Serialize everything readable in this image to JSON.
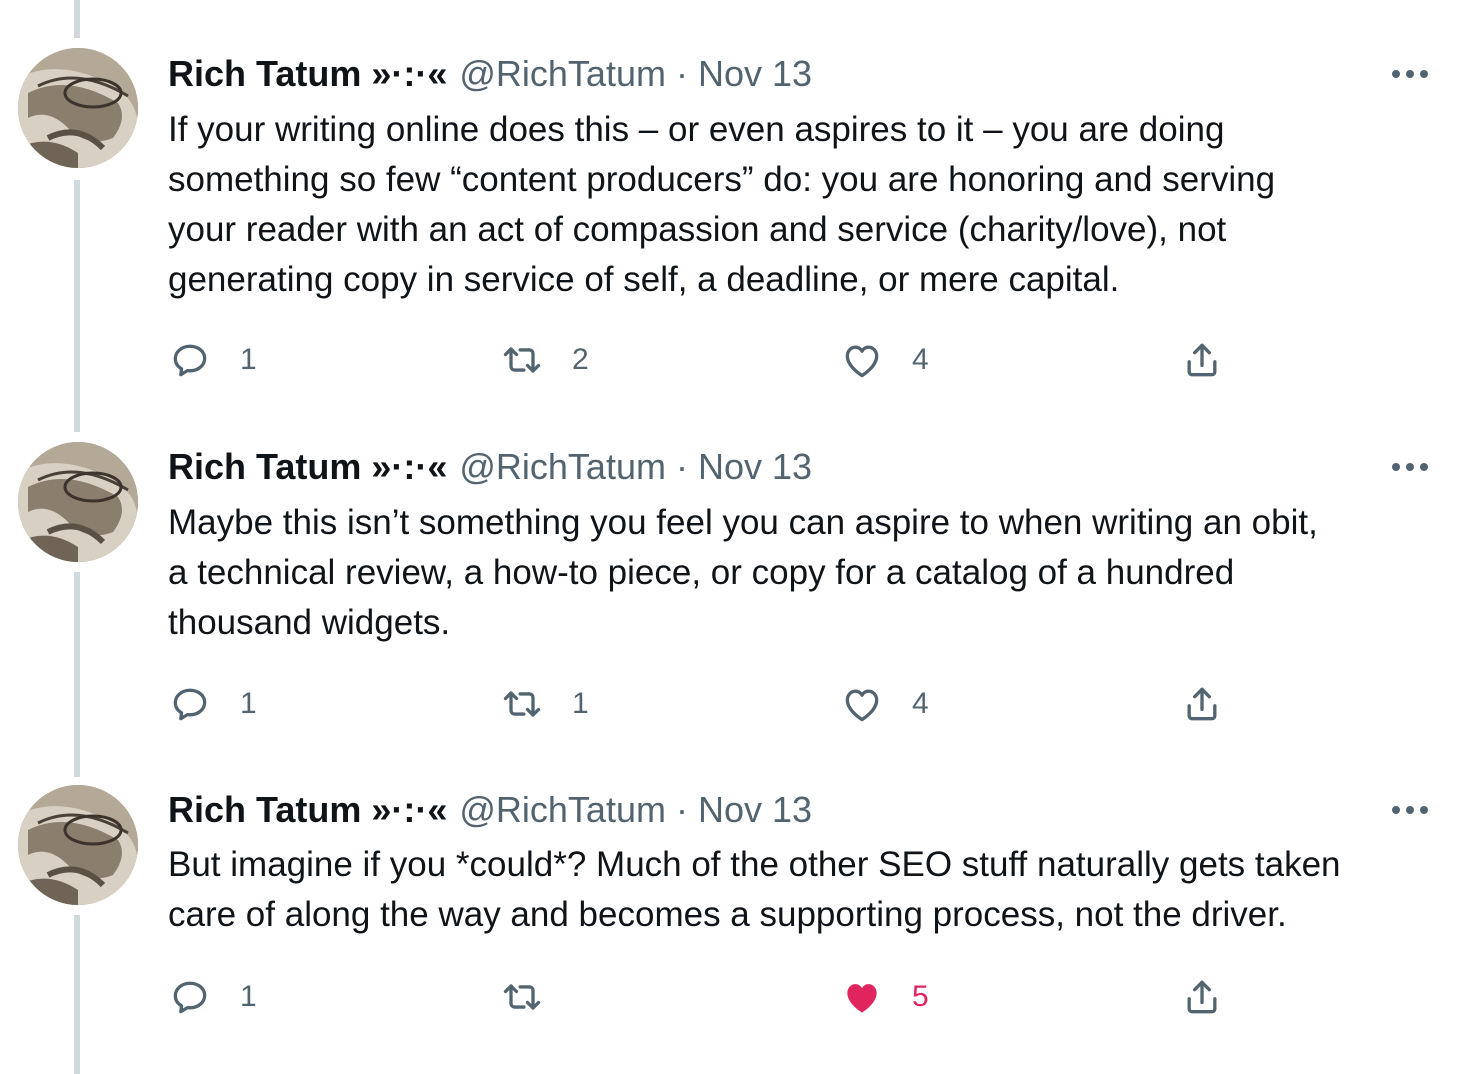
{
  "thread": {
    "tweets": [
      {
        "author": "Rich Tatum »·:·«",
        "handle": "@RichTatum",
        "separator": "·",
        "date": "Nov 13",
        "text": "If your writing online does this – or even aspires to it – you are doing\nsomething so few “content producers” do: you are honoring and serving\nyour reader with an act of compassion and service (charity/love), not\ngenerating copy in service of self, a deadline, or mere capital.",
        "replies": "1",
        "retweets": "2",
        "likes": "4",
        "liked": false
      },
      {
        "author": "Rich Tatum »·:·«",
        "handle": "@RichTatum",
        "separator": "·",
        "date": "Nov 13",
        "text": "Maybe this isn’t something you feel you can aspire to when writing an obit,\na technical review, a how-to piece, or copy for a catalog of a hundred\nthousand widgets.",
        "replies": "1",
        "retweets": "1",
        "likes": "4",
        "liked": false
      },
      {
        "author": "Rich Tatum »·:·«",
        "handle": "@RichTatum",
        "separator": "·",
        "date": "Nov 13",
        "text": "But imagine if you *could*? Much of the other SEO stuff naturally gets taken\ncare of along the way and becomes a supporting process, not the driver.",
        "replies": "1",
        "retweets": "",
        "likes": "5",
        "liked": true
      }
    ]
  },
  "colors": {
    "text": "#0f1419",
    "secondary": "#536471",
    "thread_line": "#cfd9de",
    "like_active": "#e0245e"
  },
  "icons": [
    "reply-icon",
    "retweet-icon",
    "like-icon",
    "share-icon",
    "more-icon"
  ]
}
